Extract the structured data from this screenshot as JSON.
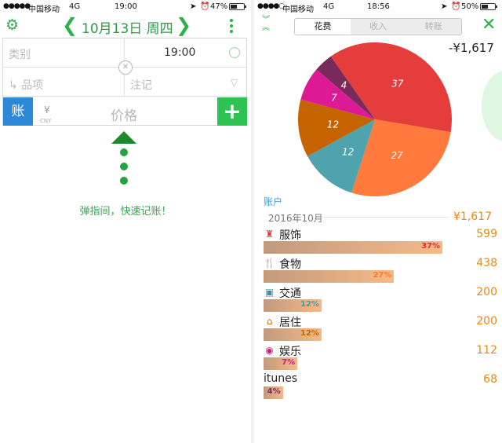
{
  "left": {
    "status": {
      "carrier": "中国移动",
      "network": "4G",
      "time": "19:00",
      "battery": "47%",
      "battery_level": 0.47
    },
    "header": {
      "date_title": "10月13日 周四"
    },
    "form": {
      "category_placeholder": "类别",
      "time_value": "19:00",
      "item_placeholder": "品项",
      "note_placeholder": "注记",
      "account_button": "账",
      "currency_symbol": "¥",
      "currency_code": "CNY",
      "price_placeholder": "价格",
      "add_button": "+"
    },
    "hint": "弹指间，快速记账！"
  },
  "right": {
    "status": {
      "carrier": "中国移动",
      "network": "4G",
      "time": "18:56",
      "battery": "50%",
      "battery_level": 0.5
    },
    "segments": [
      "花费",
      "收入",
      "转账"
    ],
    "active_segment": 0,
    "total": "-¥1,617",
    "section_title": "账户",
    "month_label": "2016年10月",
    "month_total": "¥1,617",
    "categories": [
      {
        "name": "服饰",
        "icon": "clothing-icon",
        "amount": "599",
        "percent": "37%",
        "share": 0.37,
        "pct_color": "#e22b2b"
      },
      {
        "name": "食物",
        "icon": "fork-knife-icon",
        "amount": "438",
        "percent": "27%",
        "share": 0.27,
        "pct_color": "#ff7a2a"
      },
      {
        "name": "交通",
        "icon": "bus-icon",
        "amount": "200",
        "percent": "12%",
        "share": 0.12,
        "pct_color": "#3e9fae"
      },
      {
        "name": "居住",
        "icon": "house-icon",
        "amount": "200",
        "percent": "12%",
        "share": 0.12,
        "pct_color": "#c06a00"
      },
      {
        "name": "娱乐",
        "icon": "gamepad-icon",
        "amount": "112",
        "percent": "7%",
        "share": 0.07,
        "pct_color": "#d4148c"
      },
      {
        "name": "itunes",
        "icon": "",
        "amount": "68",
        "percent": "4%",
        "share": 0.04,
        "pct_color": "#7b2b5e"
      }
    ]
  },
  "chart_data": {
    "type": "pie",
    "categories": [
      "服饰",
      "食物",
      "交通",
      "居住",
      "娱乐",
      "itunes"
    ],
    "values": [
      37,
      27,
      12,
      12,
      7,
      4
    ],
    "labels": [
      "37",
      "27",
      "12",
      "12",
      "7",
      "4"
    ],
    "colors": [
      "#e53c3c",
      "#ff7a3c",
      "#4ea3ad",
      "#c46300",
      "#dc1a96",
      "#7a2a5a"
    ]
  }
}
